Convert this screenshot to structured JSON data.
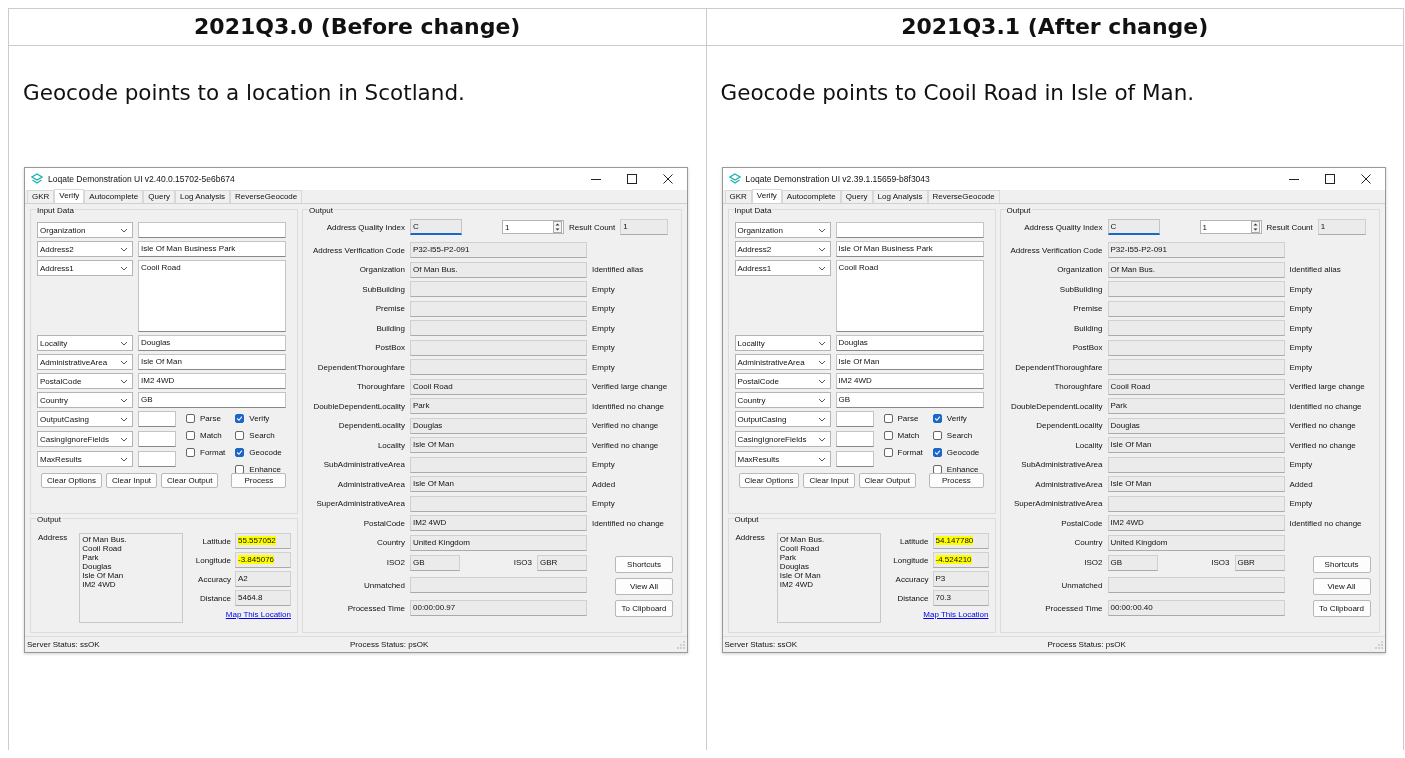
{
  "table": {
    "columns": [
      {
        "heading": "2021Q3.0 (Before change)",
        "caption": "Geocode points to a location in Scotland.",
        "window": {
          "title": "Loqate Demonstration UI v2.40.0.15702-5e6b674",
          "tabs": [
            {
              "label": "GKR",
              "selected": false
            },
            {
              "label": "Verify",
              "selected": true
            },
            {
              "label": "Autocomplete",
              "selected": false
            },
            {
              "label": "Query",
              "selected": false
            },
            {
              "label": "Log Analysis",
              "selected": false
            },
            {
              "label": "ReverseGeocode",
              "selected": false
            }
          ],
          "input_data": {
            "title": "Input Data",
            "fields": [
              {
                "field": "Organization",
                "kind": "line"
              },
              {
                "field": "Address2",
                "value": "Isle Of Man Business Park",
                "kind": "line"
              },
              {
                "field": "Address1",
                "value": "Cooil Road",
                "kind": "multiline"
              },
              {
                "field": "Locality",
                "value": "Douglas",
                "kind": "line"
              },
              {
                "field": "AdministrativeArea",
                "value": "Isle Of Man",
                "kind": "line"
              },
              {
                "field": "PostalCode",
                "value": "IM2 4WD",
                "kind": "line"
              },
              {
                "field": "Country",
                "value": "GB",
                "kind": "line"
              }
            ],
            "options": [
              {
                "field": "OutputCasing"
              },
              {
                "field": "CasingIgnoreFields"
              },
              {
                "field": "MaxResults"
              }
            ],
            "checkbox_columns": [
              [
                {
                  "label": "Parse",
                  "checked": false
                },
                {
                  "label": "Match",
                  "checked": false
                },
                {
                  "label": "Format",
                  "checked": false
                }
              ],
              [
                {
                  "label": "Verify",
                  "checked": true
                },
                {
                  "label": "Search",
                  "checked": false
                },
                {
                  "label": "Geocode",
                  "checked": true
                },
                {
                  "label": "Enhance",
                  "checked": false
                }
              ]
            ],
            "buttons": [
              "Clear Options",
              "Clear Input",
              "Clear Output",
              "Process"
            ]
          },
          "geo_output": {
            "title": "Output",
            "address_label": "Address",
            "address_lines": [
              "Of Man Bus.",
              "Cooil Road",
              "Park",
              "Douglas",
              "Isle Of Man",
              "IM2 4WD"
            ],
            "fields": [
              {
                "label": "Latitude",
                "value": "55.557052",
                "highlighted": true
              },
              {
                "label": "Longitude",
                "value": "-3.845076",
                "highlighted": true
              },
              {
                "label": "Accuracy",
                "value": "A2",
                "highlighted": false
              },
              {
                "label": "Distance",
                "value": "5464.8",
                "highlighted": false
              }
            ],
            "link": "Map This Location"
          },
          "output": {
            "title": "Output",
            "quality_index": {
              "label": "Address Quality Index",
              "value": "C",
              "focused": true
            },
            "spinner": "1",
            "result_count": {
              "label": "Result Count",
              "value": "1"
            },
            "rows": [
              {
                "label": "Address Verification Code",
                "value": "P32-I55-P2-091"
              },
              {
                "label": "Organization",
                "value": "Of Man Bus.",
                "status": "Identified alias"
              },
              {
                "label": "SubBuilding",
                "status": "Empty"
              },
              {
                "label": "Premise",
                "status": "Empty"
              },
              {
                "label": "Building",
                "status": "Empty"
              },
              {
                "label": "PostBox",
                "status": "Empty"
              },
              {
                "label": "DependentThoroughfare",
                "status": "Empty"
              },
              {
                "label": "Thoroughfare",
                "value": "Cooil Road",
                "status": "Verified large change"
              },
              {
                "label": "DoubleDependentLocality",
                "value": "Park",
                "status": "Identified no change"
              },
              {
                "label": "DependentLocality",
                "value": "Douglas",
                "status": "Verified no change"
              },
              {
                "label": "Locality",
                "value": "Isle Of Man",
                "status": "Verified no change"
              },
              {
                "label": "SubAdministrativeArea",
                "status": "Empty"
              },
              {
                "label": "AdministrativeArea",
                "value": "Isle Of Man",
                "status": "Added"
              },
              {
                "label": "SuperAdministrativeArea",
                "status": "Empty"
              },
              {
                "label": "PostalCode",
                "value": "IM2 4WD",
                "status": "Identified no change"
              },
              {
                "label": "Country",
                "value": "United Kingdom"
              }
            ],
            "lower_rows": [
              {
                "kind": "pair",
                "label": "ISO2",
                "value": "GB",
                "label2": "ISO3",
                "value2": "GBR"
              },
              {
                "kind": "field",
                "label": "Unmatched"
              },
              {
                "kind": "field",
                "label": "Processed Time",
                "value": "00:00:00.97"
              }
            ],
            "buttons": [
              "Shortcuts",
              "View All",
              "To Clipboard"
            ]
          },
          "status_bar": [
            "Server Status: ssOK",
            "Process Status: psOK"
          ]
        }
      },
      {
        "heading": "2021Q3.1 (After change)",
        "caption": "Geocode points to Cooil Road in Isle of Man.",
        "window": {
          "title": "Loqate Demonstration UI v2.39.1.15659-b8f3043",
          "tabs": [
            {
              "label": "GKR",
              "selected": false
            },
            {
              "label": "Verify",
              "selected": true
            },
            {
              "label": "Autocomplete",
              "selected": false
            },
            {
              "label": "Query",
              "selected": false
            },
            {
              "label": "Log Analysis",
              "selected": false
            },
            {
              "label": "ReverseGeocode",
              "selected": false
            }
          ],
          "input_data": {
            "title": "Input Data",
            "fields": [
              {
                "field": "Organization",
                "kind": "line"
              },
              {
                "field": "Address2",
                "value": "Isle Of Man Business Park",
                "kind": "line"
              },
              {
                "field": "Address1",
                "value": "Cooil Road",
                "kind": "multiline"
              },
              {
                "field": "Locality",
                "value": "Douglas",
                "kind": "line"
              },
              {
                "field": "AdministrativeArea",
                "value": "Isle Of Man",
                "kind": "line"
              },
              {
                "field": "PostalCode",
                "value": "IM2 4WD",
                "kind": "line"
              },
              {
                "field": "Country",
                "value": "GB",
                "kind": "line"
              }
            ],
            "options": [
              {
                "field": "OutputCasing"
              },
              {
                "field": "CasingIgnoreFields"
              },
              {
                "field": "MaxResults"
              }
            ],
            "checkbox_columns": [
              [
                {
                  "label": "Parse",
                  "checked": false
                },
                {
                  "label": "Match",
                  "checked": false
                },
                {
                  "label": "Format",
                  "checked": false
                }
              ],
              [
                {
                  "label": "Verify",
                  "checked": true
                },
                {
                  "label": "Search",
                  "checked": false
                },
                {
                  "label": "Geocode",
                  "checked": true
                },
                {
                  "label": "Enhance",
                  "checked": false
                }
              ]
            ],
            "buttons": [
              "Clear Options",
              "Clear Input",
              "Clear Output",
              "Process"
            ]
          },
          "geo_output": {
            "title": "Output",
            "address_label": "Address",
            "address_lines": [
              "Of Man Bus.",
              "Cooil Road",
              "Park",
              "Douglas",
              "Isle Of Man",
              "IM2 4WD"
            ],
            "fields": [
              {
                "label": "Latitude",
                "value": "54.147780",
                "highlighted": true
              },
              {
                "label": "Longitude",
                "value": "-4.524210",
                "highlighted": true
              },
              {
                "label": "Accuracy",
                "value": "P3",
                "highlighted": false
              },
              {
                "label": "Distance",
                "value": "70.3",
                "highlighted": false
              }
            ],
            "link": "Map This Location"
          },
          "output": {
            "title": "Output",
            "quality_index": {
              "label": "Address Quality Index",
              "value": "C",
              "focused": true
            },
            "spinner": "1",
            "result_count": {
              "label": "Result Count",
              "value": "1"
            },
            "rows": [
              {
                "label": "Address Verification Code",
                "value": "P32-I55-P2-091"
              },
              {
                "label": "Organization",
                "value": "Of Man Bus.",
                "status": "Identified alias"
              },
              {
                "label": "SubBuilding",
                "status": "Empty"
              },
              {
                "label": "Premise",
                "status": "Empty"
              },
              {
                "label": "Building",
                "status": "Empty"
              },
              {
                "label": "PostBox",
                "status": "Empty"
              },
              {
                "label": "DependentThoroughfare",
                "status": "Empty"
              },
              {
                "label": "Thoroughfare",
                "value": "Cooil Road",
                "status": "Verified large change"
              },
              {
                "label": "DoubleDependentLocality",
                "value": "Park",
                "status": "Identified no change"
              },
              {
                "label": "DependentLocality",
                "value": "Douglas",
                "status": "Verified no change"
              },
              {
                "label": "Locality",
                "value": "Isle Of Man",
                "status": "Verified no change"
              },
              {
                "label": "SubAdministrativeArea",
                "status": "Empty"
              },
              {
                "label": "AdministrativeArea",
                "value": "Isle Of Man",
                "status": "Added"
              },
              {
                "label": "SuperAdministrativeArea",
                "status": "Empty"
              },
              {
                "label": "PostalCode",
                "value": "IM2 4WD",
                "status": "Identified no change"
              },
              {
                "label": "Country",
                "value": "United Kingdom"
              }
            ],
            "lower_rows": [
              {
                "kind": "pair",
                "label": "ISO2",
                "value": "GB",
                "label2": "ISO3",
                "value2": "GBR"
              },
              {
                "kind": "field",
                "label": "Unmatched"
              },
              {
                "kind": "field",
                "label": "Processed Time",
                "value": "00:00:00.40"
              }
            ],
            "buttons": [
              "Shortcuts",
              "View All",
              "To Clipboard"
            ]
          },
          "status_bar": [
            "Server Status: ssOK",
            "Process Status: psOK"
          ]
        }
      }
    ]
  }
}
